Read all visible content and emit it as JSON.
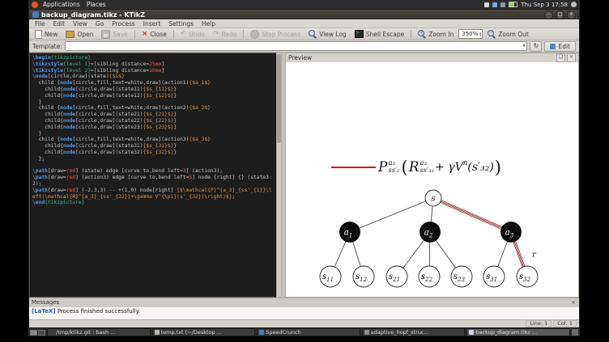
{
  "panel": {
    "applications": "Applications",
    "places": "Places",
    "clock": "Thu Sep 3 17:58"
  },
  "window": {
    "title": "backup_diagram.tikz - KTikZ",
    "menus": [
      "File",
      "Edit",
      "View",
      "Go",
      "Process",
      "Insert",
      "Settings",
      "Help"
    ]
  },
  "toolbar": {
    "new": "New",
    "open": "Open",
    "save": "Save",
    "close": "Close",
    "undo": "Undo",
    "redo": "Redo",
    "stop": "Stop Process",
    "view_log": "View Log",
    "shell_escape": "Shell Escape",
    "zoom_in": "Zoom In",
    "zoom_value": "350%",
    "zoom_out": "Zoom Out"
  },
  "template": {
    "label": "Template:",
    "edit": "Edit"
  },
  "editor": {
    "lines": [
      [
        [
          "kw",
          "\\begin"
        ],
        [
          "arg",
          "{tikzpicture}"
        ]
      ],
      [
        [
          "kw",
          "\\tikzstyle"
        ],
        [
          "arg",
          "{level 1}"
        ],
        [
          "pl",
          "=[sibling distance="
        ],
        [
          "num",
          "25mm"
        ],
        [
          "pl",
          "]"
        ]
      ],
      [
        [
          "kw",
          "\\tikzstyle"
        ],
        [
          "arg",
          "{level 2}"
        ],
        [
          "pl",
          "=[sibling distance="
        ],
        [
          "num",
          "10mm"
        ],
        [
          "pl",
          "]"
        ]
      ],
      [
        [
          "kw",
          "\\node"
        ],
        [
          "pl",
          "[circle,draw](state)"
        ],
        [
          "math",
          "{$s$}"
        ]
      ],
      [
        [
          "pl",
          "  child {"
        ],
        [
          "kw",
          "node"
        ],
        [
          "pl",
          "[circle,fill,text=white,draw](action1)"
        ],
        [
          "math",
          "{$a_1$}"
        ]
      ],
      [
        [
          "pl",
          "    child{"
        ],
        [
          "kw",
          "node"
        ],
        [
          "pl",
          "[circle,draw](state11)"
        ],
        [
          "math",
          "{$s_{11}$}"
        ],
        [
          "pl",
          "}"
        ]
      ],
      [
        [
          "pl",
          "    child{"
        ],
        [
          "kw",
          "node"
        ],
        [
          "pl",
          "[circle,draw](state12)"
        ],
        [
          "math",
          "{$s_{12}$}"
        ],
        [
          "pl",
          "}"
        ]
      ],
      [
        [
          "pl",
          "  }"
        ]
      ],
      [
        [
          "pl",
          "  child {"
        ],
        [
          "kw",
          "node"
        ],
        [
          "pl",
          "[circle,fill,text=white,draw](action2)"
        ],
        [
          "math",
          "{$a_2$}"
        ]
      ],
      [
        [
          "pl",
          "    child{"
        ],
        [
          "kw",
          "node"
        ],
        [
          "pl",
          "[circle,draw](state21)"
        ],
        [
          "math",
          "{$s_{21}$}"
        ],
        [
          "pl",
          "}"
        ]
      ],
      [
        [
          "pl",
          "    child{"
        ],
        [
          "kw",
          "node"
        ],
        [
          "pl",
          "[circle,draw](state22)"
        ],
        [
          "math",
          "{$s_{22}$}"
        ],
        [
          "pl",
          "}"
        ]
      ],
      [
        [
          "pl",
          "    child{"
        ],
        [
          "kw",
          "node"
        ],
        [
          "pl",
          "[circle,draw](state23)"
        ],
        [
          "math",
          "{$s_{23}$}"
        ],
        [
          "pl",
          "}"
        ]
      ],
      [
        [
          "pl",
          "  }"
        ]
      ],
      [
        [
          "pl",
          "  child {"
        ],
        [
          "kw",
          "node"
        ],
        [
          "pl",
          "[circle,fill,text=white,draw](action3)"
        ],
        [
          "math",
          "{$a_3$}"
        ]
      ],
      [
        [
          "pl",
          "    child{"
        ],
        [
          "kw",
          "node"
        ],
        [
          "pl",
          "[circle,draw](state31)"
        ],
        [
          "math",
          "{$s_{31}$}"
        ],
        [
          "pl",
          "}"
        ]
      ],
      [
        [
          "pl",
          "    child{"
        ],
        [
          "kw",
          "node"
        ],
        [
          "pl",
          "[circle,draw](state32)"
        ],
        [
          "math",
          "{$s_{32}$}"
        ],
        [
          "pl",
          "}"
        ]
      ],
      [
        [
          "pl",
          "  };"
        ]
      ],
      [],
      [
        [
          "kw",
          "\\path"
        ],
        [
          "pl",
          "[draw="
        ],
        [
          "num",
          "red"
        ],
        [
          "pl",
          "] (state) edge [curve to,bend left="
        ],
        [
          "num",
          "3"
        ],
        [
          "pl",
          "] (action3);"
        ]
      ],
      [
        [
          "kw",
          "\\path"
        ],
        [
          "pl",
          "[draw="
        ],
        [
          "num",
          "red"
        ],
        [
          "pl",
          "] (action3) edge [curve to,bend left="
        ],
        [
          "num",
          "5"
        ],
        [
          "pl",
          "] node {right} {} (state32);"
        ]
      ],
      [
        [
          "kw",
          "\\path"
        ],
        [
          "pl",
          "[draw="
        ],
        [
          "num",
          "red"
        ],
        [
          "pl",
          "] (-2.3,3) -- +(1,0) node[right] "
        ],
        [
          "math",
          "{$\\mathcal{P}^{a_3}_{ss'_{1}}\\left(\\mathcal{R}^{a_3}_{ss'_{32}}+\\gamma V^{\\pi}(s'_{32})\\right)$}"
        ],
        [
          "pl",
          ";"
        ]
      ],
      [
        [
          "kw",
          "\\end"
        ],
        [
          "arg",
          "{tikzpicture}"
        ]
      ]
    ]
  },
  "preview": {
    "title": "Preview",
    "formula": {
      "p": "P",
      "p_sup": "a₃",
      "p_sub": "ss′₁",
      "lparen": "(",
      "r": "R",
      "r_sup": "a₃",
      "r_sub": "ss′₃₂",
      "mid": "+ γV",
      "mid_sup": "π",
      "tail": "(s′₃₂)",
      "rparen": ")"
    },
    "tree": {
      "root": "s",
      "actions": [
        {
          "m": "a",
          "s": "1"
        },
        {
          "m": "a",
          "s": "2"
        },
        {
          "m": "a",
          "s": "3"
        }
      ],
      "leaves": [
        {
          "m": "s",
          "s": "11"
        },
        {
          "m": "s",
          "s": "12"
        },
        {
          "m": "s",
          "s": "21"
        },
        {
          "m": "s",
          "s": "22"
        },
        {
          "m": "s",
          "s": "23"
        },
        {
          "m": "s",
          "s": "31"
        },
        {
          "m": "s",
          "s": "32"
        }
      ],
      "edge_label": "r",
      "highlight_color": "#c0202a"
    }
  },
  "messages": {
    "title": "Messages",
    "tag": "[LaTeX]",
    "text": "Process finished successfully."
  },
  "statusbar": {
    "line": "Line: 1",
    "col": "Col: 1"
  },
  "taskbar": [
    {
      "label": "/tmp/ktikz.git : bash ...",
      "icon": "terminal-icon",
      "color": "#3c3f44",
      "active": false
    },
    {
      "label": "temp.txt (~/Desktop ...",
      "icon": "text-editor-icon",
      "color": "#b8b8b4",
      "active": false
    },
    {
      "label": "SpeedCrunch",
      "icon": "calculator-icon",
      "color": "#4a78c2",
      "active": false
    },
    {
      "label": "adaptive_hopf_struc...",
      "icon": "document-icon",
      "color": "#8a8a8a",
      "active": false
    },
    {
      "label": "backup_diagram.tikz ...",
      "icon": "ktikz-icon",
      "color": "#cfd4e8",
      "active": true
    }
  ]
}
